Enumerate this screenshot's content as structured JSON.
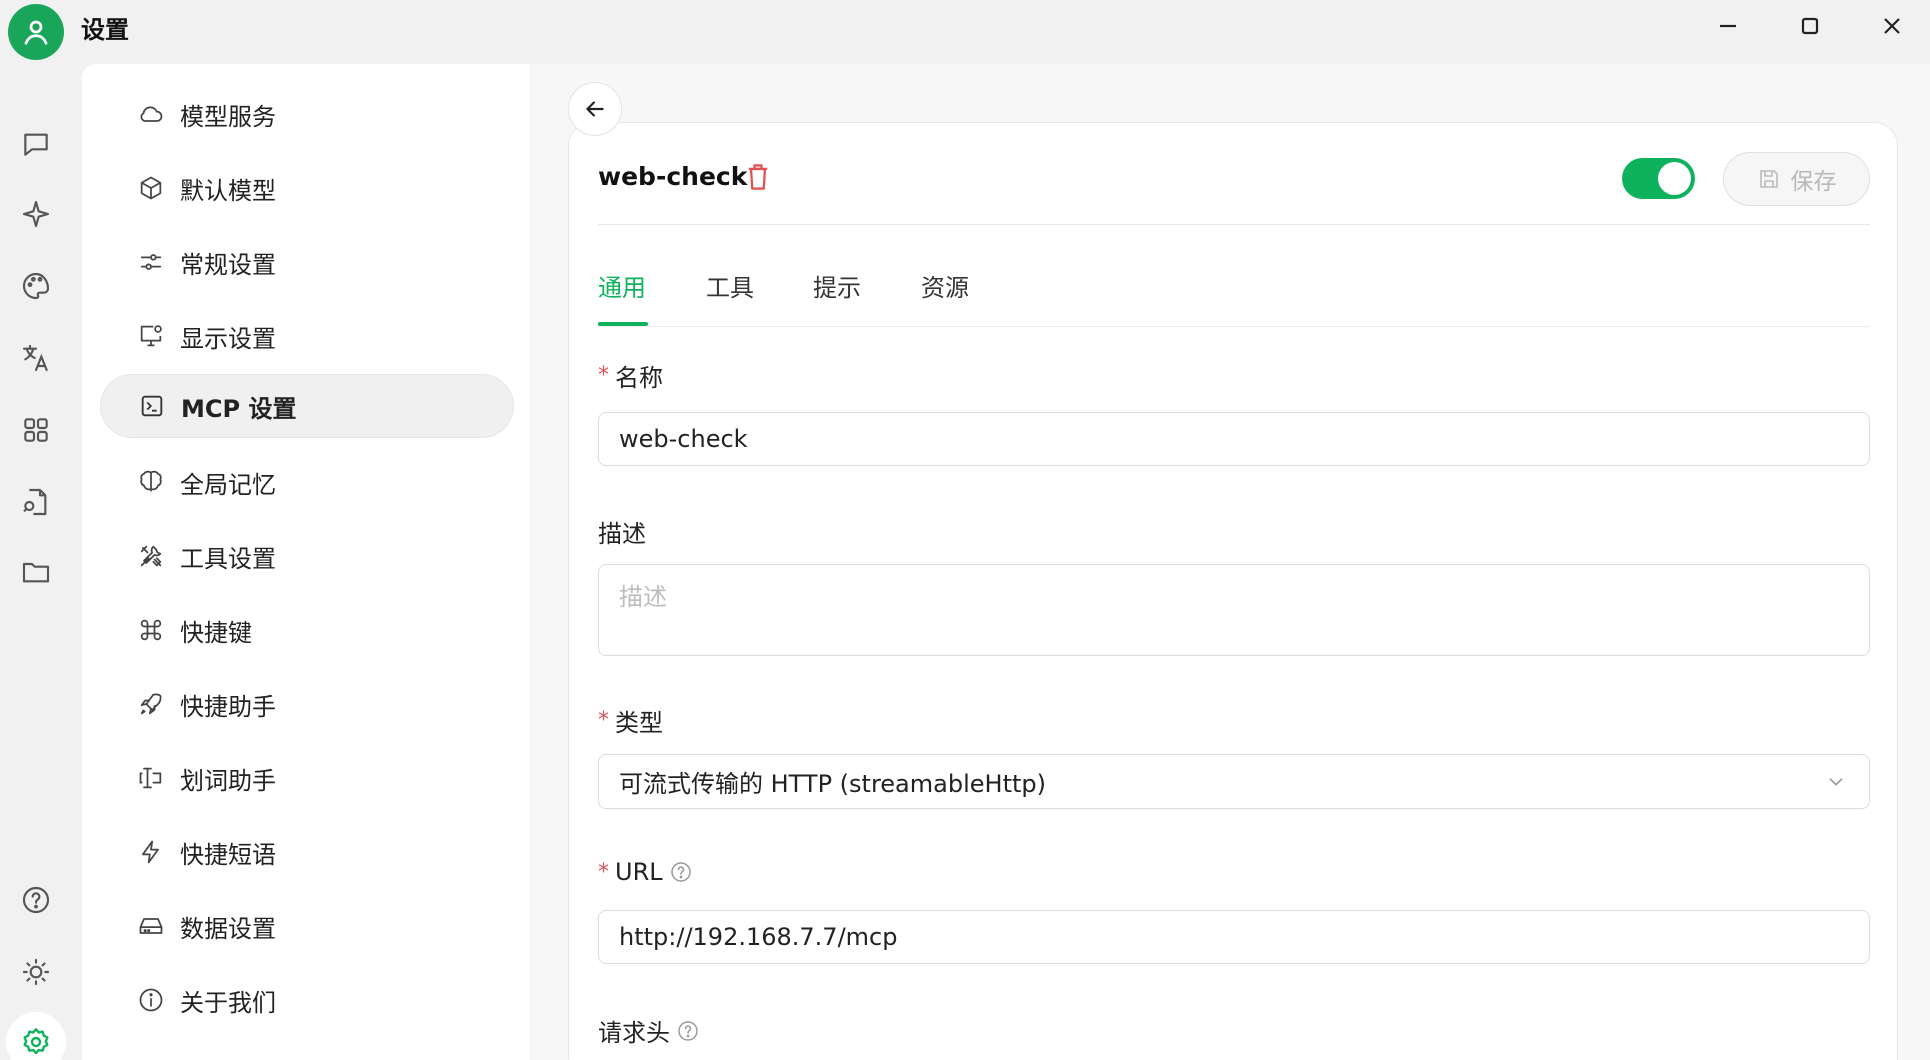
{
  "window": {
    "title": "设置"
  },
  "menu": {
    "items": [
      {
        "label": "模型服务",
        "icon": "cloud-icon"
      },
      {
        "label": "默认模型",
        "icon": "cube-icon"
      },
      {
        "label": "常规设置",
        "icon": "sliders-icon"
      },
      {
        "label": "显示设置",
        "icon": "monitor-icon"
      },
      {
        "label": "MCP 设置",
        "icon": "terminal-icon",
        "active": true
      },
      {
        "label": "全局记忆",
        "icon": "brain-icon"
      },
      {
        "label": "工具设置",
        "icon": "tools-icon"
      },
      {
        "label": "快捷键",
        "icon": "command-icon"
      },
      {
        "label": "快捷助手",
        "icon": "rocket-icon"
      },
      {
        "label": "划词助手",
        "icon": "text-cursor-icon"
      },
      {
        "label": "快捷短语",
        "icon": "zap-icon"
      },
      {
        "label": "数据设置",
        "icon": "hard-drive-icon"
      },
      {
        "label": "关于我们",
        "icon": "info-icon"
      }
    ]
  },
  "server": {
    "name": "web-check",
    "enabled": true,
    "save_label": "保存"
  },
  "tabs": [
    "通用",
    "工具",
    "提示",
    "资源"
  ],
  "form": {
    "name_label": "名称",
    "name_value": "web-check",
    "desc_label": "描述",
    "desc_placeholder": "描述",
    "type_label": "类型",
    "type_value": "可流式传输的 HTTP (streamableHttp)",
    "url_label": "URL",
    "url_value": "http://192.168.7.7/mcp",
    "headers_label": "请求头",
    "required_mark": "*"
  },
  "colors": {
    "accent": "#0fb25c",
    "danger": "#e25454"
  }
}
